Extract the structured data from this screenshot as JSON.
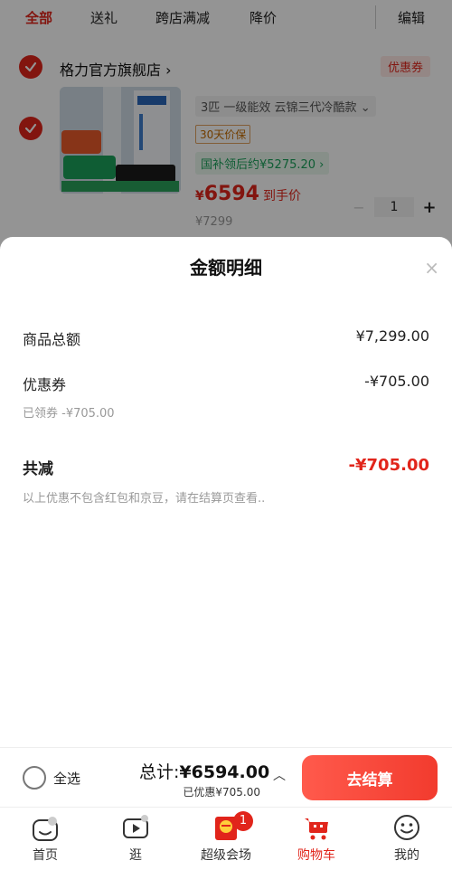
{
  "tabs": [
    {
      "label": "全部",
      "active": true
    },
    {
      "label": "送礼"
    },
    {
      "label": "跨店满减"
    },
    {
      "label": "降价"
    }
  ],
  "edit_label": "编辑",
  "store": {
    "name": "格力官方旗舰店",
    "chevron": "›",
    "coupon_tag": "优惠券"
  },
  "product": {
    "spec": "3匹 一级能效 云锦三代冷酷款",
    "spec_chevron": "⌄",
    "guarantee": "30天价保",
    "subsidy": "国补领后约¥5275.20",
    "subsidy_chevron": "›",
    "price_symbol": "¥",
    "price": "6594",
    "price_suffix": "到手价",
    "original_price": "¥7299",
    "quantity": "1",
    "minus": "−",
    "plus": "+"
  },
  "sheet": {
    "title": "金额明细",
    "close": "×",
    "rows": [
      {
        "label": "商品总额",
        "value": "¥7,299.00"
      },
      {
        "label": "优惠券",
        "value": "-¥705.00",
        "sub": "已领券 -¥705.00"
      }
    ],
    "total_label": "共减",
    "total_value": "-¥705.00",
    "note": "以上优惠不包含红包和京豆，请在结算页查看.."
  },
  "checkout": {
    "select_all": "全选",
    "total_prefix": "总计:",
    "total_amount": "¥6594.00",
    "saved": "已优惠¥705.00",
    "caret": "︿",
    "button": "去结算"
  },
  "nav": [
    {
      "label": "首页",
      "icon": "home-icon"
    },
    {
      "label": "逛",
      "icon": "video-icon"
    },
    {
      "label": "超级会场",
      "icon": "promo-icon",
      "badge": "1"
    },
    {
      "label": "购物车",
      "icon": "cart-icon",
      "active": true
    },
    {
      "label": "我的",
      "icon": "profile-icon"
    }
  ],
  "colors": {
    "accent": "#e1251b",
    "subsidy_green": "#1aa05a",
    "overlay": "rgba(0,0,0,0.42)"
  }
}
